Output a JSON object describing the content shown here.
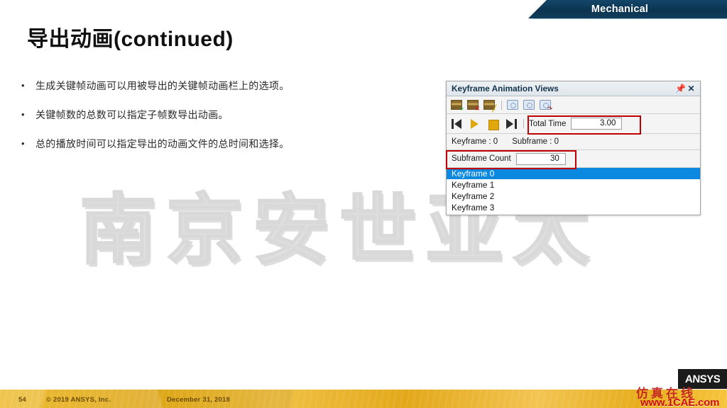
{
  "banner": {
    "title": "Mechanical"
  },
  "slide": {
    "title": "导出动画(continued)",
    "watermark": "南京安世亚太",
    "bullets": [
      {
        "marker": "•",
        "text": "生成关键帧动画可以用被导出的关键帧动画栏上的选项。"
      },
      {
        "marker": "•",
        "text": "关键帧数的总数可以指定子帧数导出动画。"
      },
      {
        "marker": "•",
        "text": "总的播放时间可以指定导出的动画文件的总时间和选择。"
      }
    ]
  },
  "panel": {
    "title": "Keyframe Animation Views",
    "pin_icon": "pin-icon",
    "close_icon": "close-icon",
    "toolbar": [
      {
        "name": "add-keyframe-icon",
        "badge": "+",
        "badge_color": "#1f9d2a",
        "kind": "sheet"
      },
      {
        "name": "delete-keyframe-icon",
        "badge": "✕",
        "badge_color": "#c02727",
        "kind": "sheet"
      },
      {
        "name": "edit-keyframe-icon",
        "badge": "╱",
        "badge_color": "#c9a000",
        "kind": "sheet"
      },
      {
        "name": "export-video-icon",
        "badge": "",
        "badge_color": "",
        "kind": "camera"
      },
      {
        "name": "export-image-icon",
        "badge": "",
        "badge_color": "",
        "kind": "camera"
      },
      {
        "name": "import-view-icon",
        "badge": "↶",
        "badge_color": "#a23b3b",
        "kind": "camera"
      }
    ],
    "playback": [
      {
        "name": "skip-to-start-button"
      },
      {
        "name": "play-button"
      },
      {
        "name": "stop-button"
      },
      {
        "name": "skip-to-end-button"
      }
    ],
    "total_time": {
      "label": "Total Time",
      "value": "3.00",
      "highlight_color": "#c00000"
    },
    "info": {
      "keyframe_label": "Keyframe : 0",
      "subframe_label": "Subframe : 0"
    },
    "subframe_count": {
      "label": "Subframe Count",
      "value": "30",
      "highlight_color": "#c00000"
    },
    "keyframe_list": [
      {
        "label": "Keyframe 0",
        "selected": true
      },
      {
        "label": "Keyframe 1",
        "selected": false
      },
      {
        "label": "Keyframe 2",
        "selected": false
      },
      {
        "label": "Keyframe 3",
        "selected": false
      }
    ],
    "selection_color": "#0b88e0"
  },
  "footer": {
    "page_number": "54",
    "copyright": "© 2019 ANSYS,  Inc.",
    "date": "December  31, 2018",
    "bar_color": "#eeb21c"
  },
  "branding": {
    "logo_text": "ANSYS",
    "cn_mark": "仿真在线",
    "site": "www.1CAE.com",
    "site_color": "#c81010"
  }
}
